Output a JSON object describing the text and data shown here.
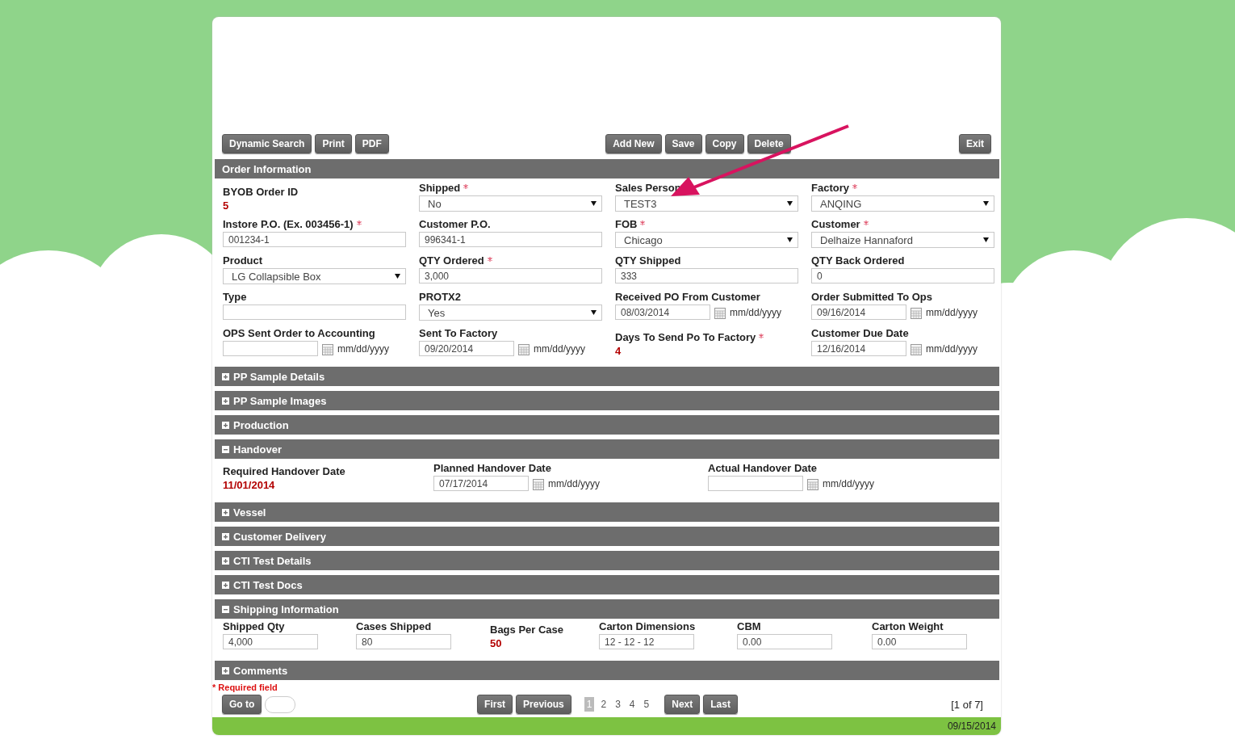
{
  "toolbar": {
    "left": [
      "Dynamic Search",
      "Print",
      "PDF"
    ],
    "center": [
      "Add New",
      "Save",
      "Copy",
      "Delete"
    ],
    "right": [
      "Exit"
    ]
  },
  "sections": [
    {
      "title": "Order Information",
      "fields": [
        {
          "label": "BYOB Order ID",
          "kind": "value",
          "value": "5"
        },
        {
          "label": "Shipped",
          "kind": "select",
          "required": true,
          "value": "No"
        },
        {
          "label": "Sales Person",
          "kind": "select",
          "value": "TEST3"
        },
        {
          "label": "Factory",
          "kind": "select",
          "required": true,
          "value": "ANQING"
        },
        {
          "label": "Instore P.O. (Ex. 003456-1)",
          "kind": "text",
          "required": true,
          "value": "001234-1"
        },
        {
          "label": "Customer P.O.",
          "kind": "text",
          "value": "996341-1"
        },
        {
          "label": "FOB",
          "kind": "select",
          "required": true,
          "value": "Chicago"
        },
        {
          "label": "Customer",
          "kind": "select",
          "required": true,
          "value": "Delhaize Hannaford"
        },
        {
          "label": "Product",
          "kind": "select",
          "value": "LG Collapsible Box"
        },
        {
          "label": "QTY Ordered",
          "kind": "text",
          "required": true,
          "value": "3,000"
        },
        {
          "label": "QTY Shipped",
          "kind": "text",
          "value": "333"
        },
        {
          "label": "QTY Back Ordered",
          "kind": "text",
          "value": "0"
        },
        {
          "label": "Type",
          "kind": "text"
        },
        {
          "label": "PROTX2",
          "kind": "select",
          "value": "Yes"
        },
        {
          "label": "Received PO From Customer",
          "kind": "date",
          "value": "08/03/2014",
          "format": "mm/dd/yyyy"
        },
        {
          "label": "Order Submitted To Ops",
          "kind": "date",
          "value": "09/16/2014",
          "format": "mm/dd/yyyy"
        },
        {
          "label": "OPS Sent Order to Accounting",
          "kind": "date",
          "format": "mm/dd/yyyy"
        },
        {
          "label": "Sent To Factory",
          "kind": "date",
          "value": "09/20/2014",
          "format": "mm/dd/yyyy"
        },
        {
          "label": "Days To Send Po To Factory",
          "kind": "value",
          "required": true,
          "value": "4"
        },
        {
          "label": "Customer Due Date",
          "kind": "date",
          "value": "12/16/2014",
          "format": "mm/dd/yyyy"
        }
      ]
    },
    {
      "title": "PP Sample Details",
      "expanded": false
    },
    {
      "title": "PP Sample Images",
      "expanded": false
    },
    {
      "title": "Production",
      "expanded": false
    },
    {
      "title": "Handover",
      "expanded": true,
      "fields": [
        {
          "label": "Required Handover Date",
          "kind": "value",
          "value": "11/01/2014"
        },
        {
          "label": "Planned Handover Date",
          "kind": "date",
          "value": "07/17/2014",
          "format": "mm/dd/yyyy"
        },
        {
          "label": "Actual Handover Date",
          "kind": "date",
          "format": "mm/dd/yyyy"
        }
      ]
    },
    {
      "title": "Vessel",
      "expanded": false
    },
    {
      "title": "Customer Delivery",
      "expanded": false
    },
    {
      "title": "CTI Test Details",
      "expanded": false
    },
    {
      "title": "CTI Test Docs",
      "expanded": false
    },
    {
      "title": "Shipping Information",
      "expanded": true,
      "fields": [
        {
          "label": "Shipped Qty",
          "kind": "text",
          "value": "4,000"
        },
        {
          "label": "Cases Shipped",
          "kind": "text",
          "value": "80"
        },
        {
          "label": "Bags Per Case",
          "kind": "value",
          "value": "50"
        },
        {
          "label": "Carton Dimensions",
          "kind": "text",
          "value": "12 - 12 - 12"
        },
        {
          "label": "CBM",
          "kind": "text",
          "value": "0.00"
        },
        {
          "label": "Carton Weight",
          "kind": "text",
          "value": "0.00"
        }
      ]
    },
    {
      "title": "Comments",
      "expanded": false
    }
  ],
  "required_note": "* Required field",
  "pager": {
    "goto": "Go to",
    "first": "First",
    "previous": "Previous",
    "pages": [
      {
        "label": "1",
        "selected": true
      },
      {
        "label": "2",
        "selected": false
      },
      {
        "label": "3",
        "selected": false
      },
      {
        "label": "4",
        "selected": false
      },
      {
        "label": "5",
        "selected": false
      }
    ],
    "next": "Next",
    "last": "Last",
    "count": "[1 of 7]"
  },
  "status_bar": {
    "date": "09/15/2014"
  }
}
